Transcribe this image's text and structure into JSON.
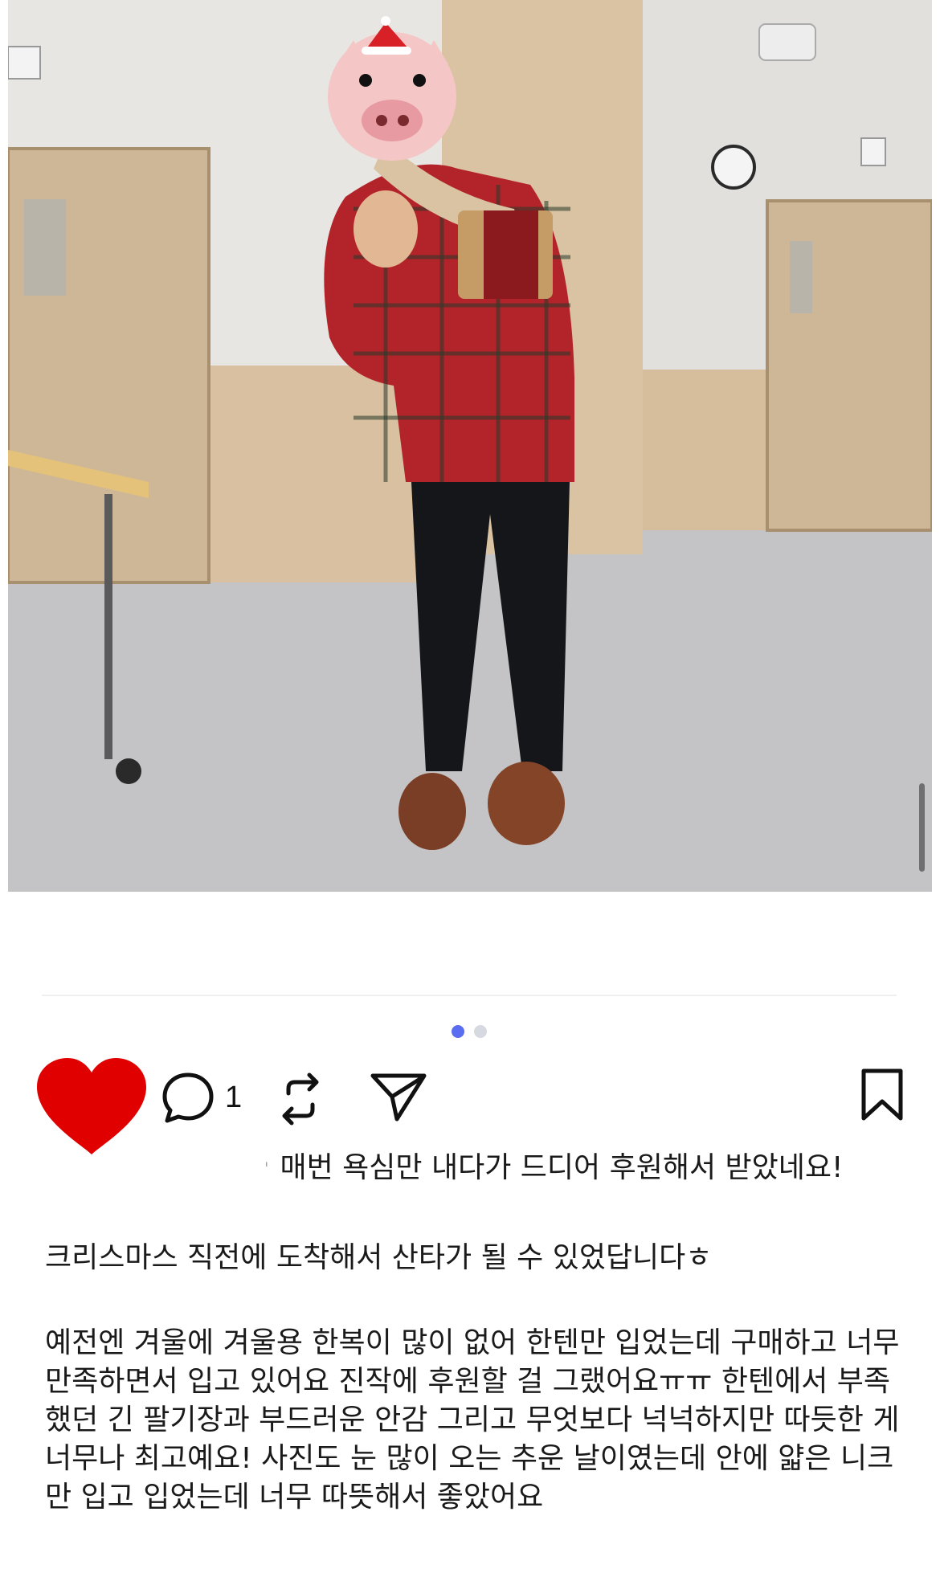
{
  "post": {
    "photo_alt": "photo",
    "pager": {
      "count": 2,
      "active": 0
    },
    "actions": {
      "comment_count": "1"
    },
    "caption": {
      "line1_mark": "ˈ",
      "line1": "매번 욕심만 내다가 드디어 후원해서 받았네요!",
      "line2": "크리스마스 직전에 도착해서 산타가 될 수 있었답니다ㅎ",
      "paragraph3": "예전엔 겨울에 겨울용 한복이 많이 없어 한텐만 입었는데 구매하고 너무 만족하면서 입고 있어요 진작에 후원할 걸 그랬어요ㅠㅠ 한텐에서 부족했던 긴 팔기장과 부드러운 안감 그리고 무엇보다 넉넉하지만 따듯한 게 너무나 최고예요! 사진도 눈 많이 오는 추운 날이였는데 안에 얇은 니크만 입고 입었는데 너무 따뜻해서 좋았어요"
    }
  },
  "colors": {
    "heart": "#e00000",
    "pager_active": "#5a6cf0",
    "pager_inactive": "#d6d9df",
    "text": "#1a1a1a"
  },
  "icons": {
    "like": "heart-icon",
    "comment": "comment-bubble-icon",
    "repost": "repost-icon",
    "share": "paper-plane-icon",
    "bookmark": "bookmark-icon"
  }
}
